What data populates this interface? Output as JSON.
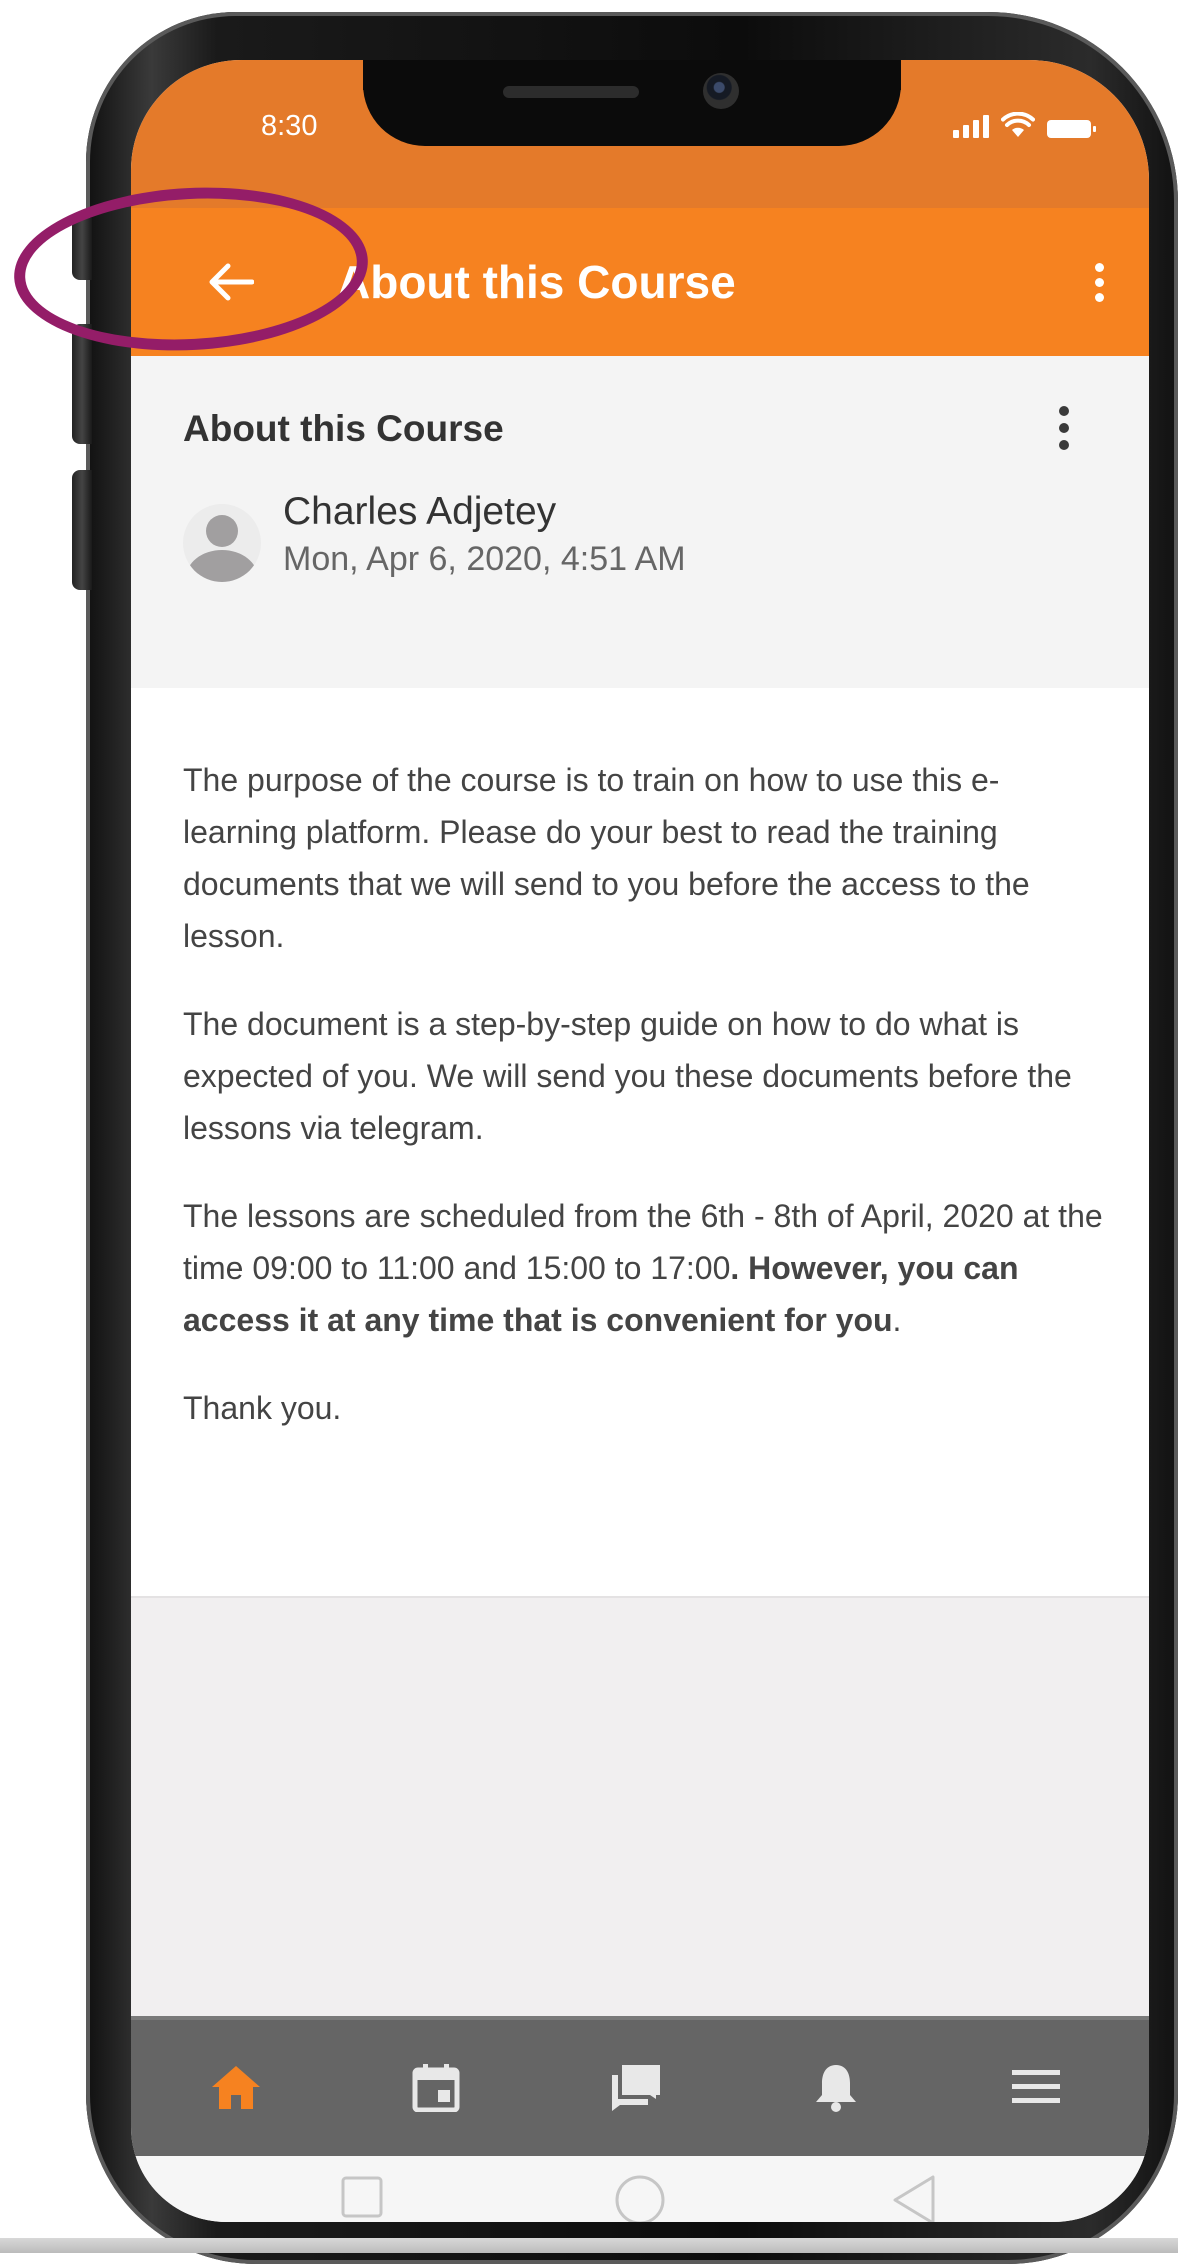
{
  "colors": {
    "status_bar": "#e47a2a",
    "app_bar": "#f68220",
    "highlight_ring": "#941d68",
    "bottom_nav": "#656565",
    "active_nav_icon": "#f68220"
  },
  "status_bar": {
    "time": "8:30",
    "icons": [
      "signal-icon",
      "wifi-icon",
      "battery-icon"
    ]
  },
  "app_bar": {
    "back_icon": "arrow-left-icon",
    "title": "About this Course",
    "menu_icon": "more-vertical-icon"
  },
  "post": {
    "title": "About this Course",
    "menu_icon": "more-vertical-icon",
    "author": {
      "name": "Charles Adjetey",
      "avatar_icon": "user-avatar-icon"
    },
    "date": "Mon, Apr 6, 2020, 4:51 AM",
    "paragraphs": [
      "The purpose of the course is to train on how to use this e-learning platform. Please do your best to read the training documents that we will send to you before the access to the lesson.",
      "The document is a step-by-step guide on how to do what is expected of you. We will send you these documents before the lessons via telegram."
    ],
    "schedule_paragraph": {
      "regular": "The lessons are scheduled from the 6th - 8th of April, 2020 at the time 09:00 to 11:00 and 15:00 to 17:00",
      "bold": ". However, you can access it at any time that is convenient for you",
      "end": "."
    },
    "closing": "Thank you."
  },
  "bottom_nav": {
    "items": [
      {
        "icon": "home-icon",
        "active": true
      },
      {
        "icon": "calendar-icon",
        "active": false
      },
      {
        "icon": "messages-icon",
        "active": false
      },
      {
        "icon": "bell-icon",
        "active": false
      },
      {
        "icon": "menu-icon",
        "active": false
      }
    ]
  },
  "system_nav": {
    "items": [
      "recent-apps-icon",
      "home-circle-icon",
      "back-triangle-icon"
    ]
  }
}
